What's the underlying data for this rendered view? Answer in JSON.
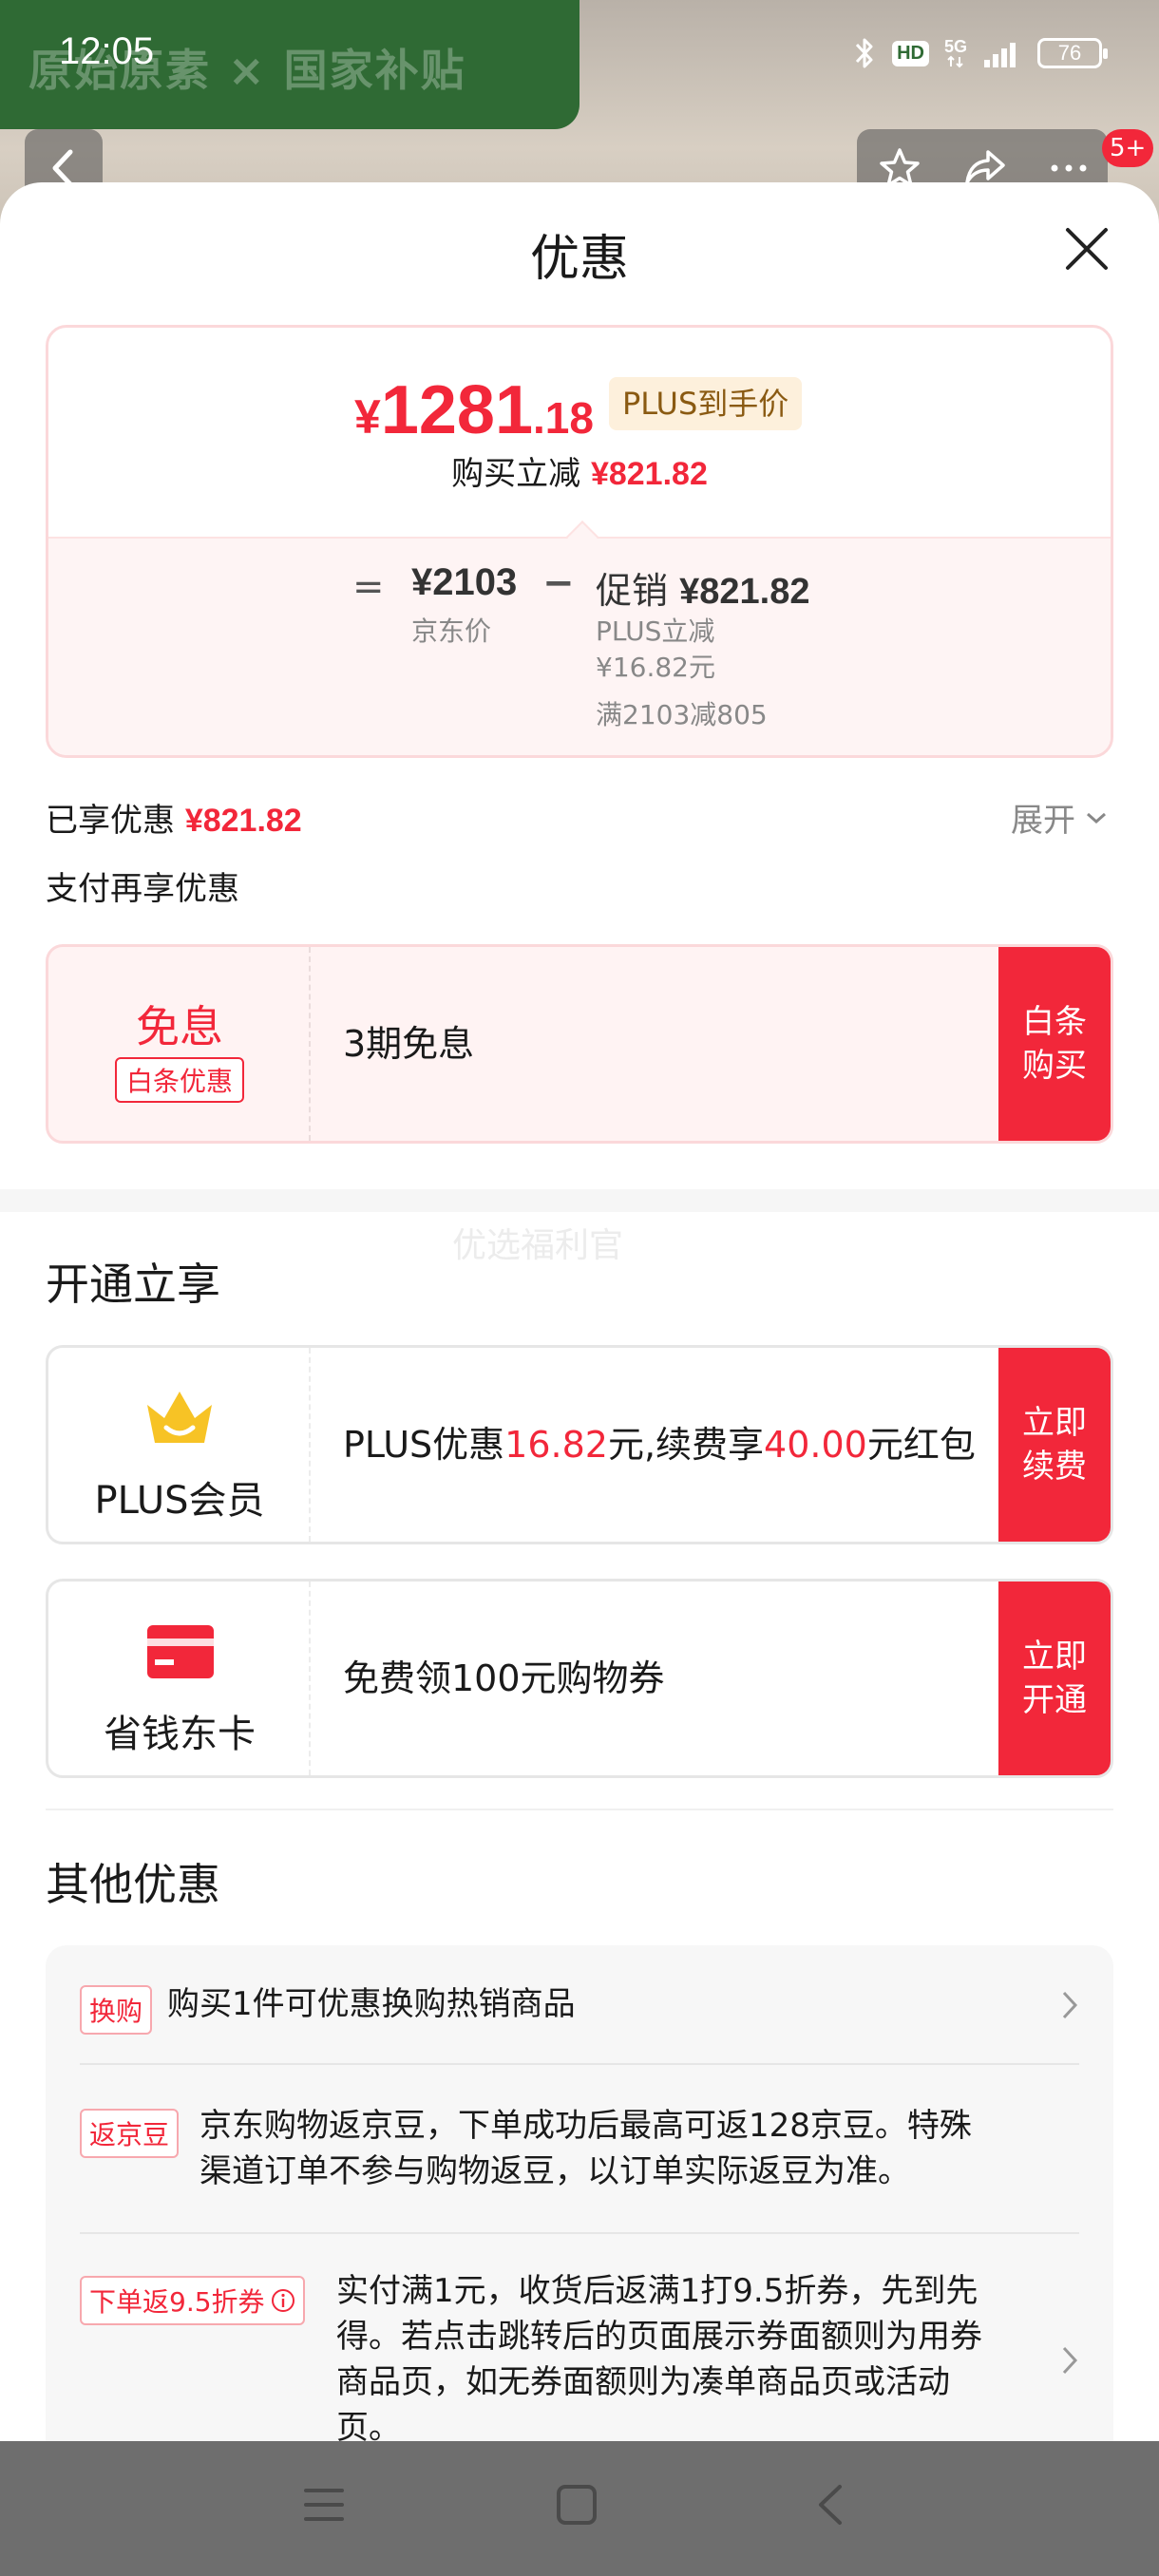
{
  "status": {
    "time": "12:05",
    "battery": "76",
    "hd": "HD",
    "network": "5G"
  },
  "background": {
    "banner_text": "原始原素 × 国家补贴",
    "badge": "5+"
  },
  "sheet": {
    "title": "优惠"
  },
  "price": {
    "yen": "¥",
    "integer": "1281",
    "decimal": ".18",
    "plus_tag": "PLUS到手价",
    "reduce_label": "购买立减",
    "reduce_value": "¥821.82",
    "equals": "=",
    "jd_price": "¥2103",
    "jd_label": "京东价",
    "minus": "−",
    "promo_label": "促销",
    "promo_value": "¥821.82",
    "promo_line1": "PLUS立减",
    "promo_line2": "¥16.82元",
    "promo_line3": "满2103减805"
  },
  "enjoyed": {
    "label": "已享优惠",
    "value": "¥821.82",
    "expand": "展开"
  },
  "pay_again": "支付再享优惠",
  "installment": {
    "title": "免息",
    "tag": "白条优惠",
    "desc": "3期免息",
    "button_line1": "白条",
    "button_line2": "购买"
  },
  "watermark": "优选福利官",
  "open_section": {
    "title": "开通立享"
  },
  "plus_card": {
    "name": "PLUS会员",
    "desc_1": "PLUS优惠",
    "desc_num1": "16.82",
    "desc_2": "元,续费享",
    "desc_num2": "40.00",
    "desc_3": "元红包",
    "button_line1": "立即",
    "button_line2": "续费"
  },
  "dongka_card": {
    "name": "省钱东卡",
    "desc": "免费领100元购物券",
    "button_line1": "立即",
    "button_line2": "开通"
  },
  "other_section": {
    "title": "其他优惠",
    "items": [
      {
        "tag": "换购",
        "text": "购买1件可优惠换购热销商品"
      },
      {
        "tag": "返京豆",
        "text_line1": "京东购物返京豆，下单成功后最高可返128京豆。特殊",
        "text_line2": "渠道订单不参与购物返豆，以订单实际返豆为准。"
      },
      {
        "tag": "下单返9.5折券",
        "text_line1": "实付满1元，收货后返满1打9.5折券，先到先",
        "text_line2": "得。若点击跳转后的页面展示券面额则为用券",
        "text_line3": "商品页，如无券面额则为凑单商品页或活动",
        "text_line4": "页。"
      }
    ]
  },
  "colors": {
    "accent": "#f2273a",
    "plus_gold": "#f7c325",
    "card_pink": "#fff3f3"
  }
}
